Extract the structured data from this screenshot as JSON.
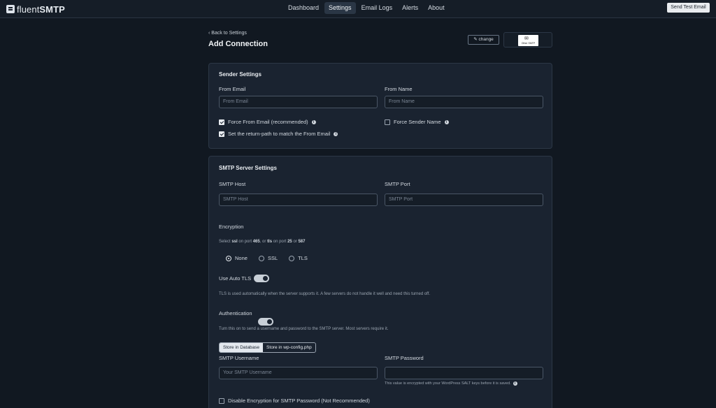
{
  "app": {
    "brand_light": "fluent",
    "brand_bold": "SMTP"
  },
  "nav": {
    "items": [
      "Dashboard",
      "Settings",
      "Email Logs",
      "Alerts",
      "About"
    ],
    "active": "Settings",
    "test_button": "Send Test Email"
  },
  "header": {
    "back_label": "Back to Settings",
    "title": "Add Connection",
    "change_label": "change",
    "provider_logo_text": "Other SMTP"
  },
  "sender": {
    "title": "Sender Settings",
    "from_email_label": "From Email",
    "from_email_placeholder": "From Email",
    "from_name_label": "From Name",
    "from_name_placeholder": "From Name",
    "force_from_email": {
      "label": "Force From Email (recommended)",
      "checked": true
    },
    "return_path": {
      "label": "Set the return-path to match the From Email",
      "checked": true
    },
    "force_sender_name": {
      "label": "Force Sender Name",
      "checked": false
    }
  },
  "smtp": {
    "title": "SMTP Server Settings",
    "host_label": "SMTP Host",
    "host_placeholder": "SMTP Host",
    "port_label": "SMTP Port",
    "port_placeholder": "SMTP Port",
    "encryption_label": "Encryption",
    "encryption_hint": {
      "p1": "Select ",
      "ssl": "ssl",
      "p2": " on port ",
      "port1": "465",
      "p3": ", or ",
      "tls": "tls",
      "p4": " on port ",
      "port2": "25",
      "p5": " or ",
      "port3": "587"
    },
    "encryption_options": [
      "None",
      "SSL",
      "TLS"
    ],
    "encryption_selected": "None",
    "auto_tls_label": "Use Auto TLS",
    "auto_tls_on": true,
    "auto_tls_hint": "TLS is used automatically when the server supports it. A few servers do not handle it well and need this turned off.",
    "auth_label": "Authentication",
    "auth_on": true,
    "auth_hint": "Turn this on to send a username and password to the SMTP server. Most servers require it.",
    "store_options": [
      "Store in Database",
      "Store in wp-config.php"
    ],
    "store_selected": "Store in Database",
    "username_label": "SMTP Username",
    "username_placeholder": "Your SMTP Username",
    "password_label": "SMTP Password",
    "password_note": "This value is encrypted with your WordPress SALT keys before it is saved.",
    "disable_encryption": {
      "label": "Disable Encryption for SMTP Password (Not Recommended)",
      "checked": false
    }
  }
}
